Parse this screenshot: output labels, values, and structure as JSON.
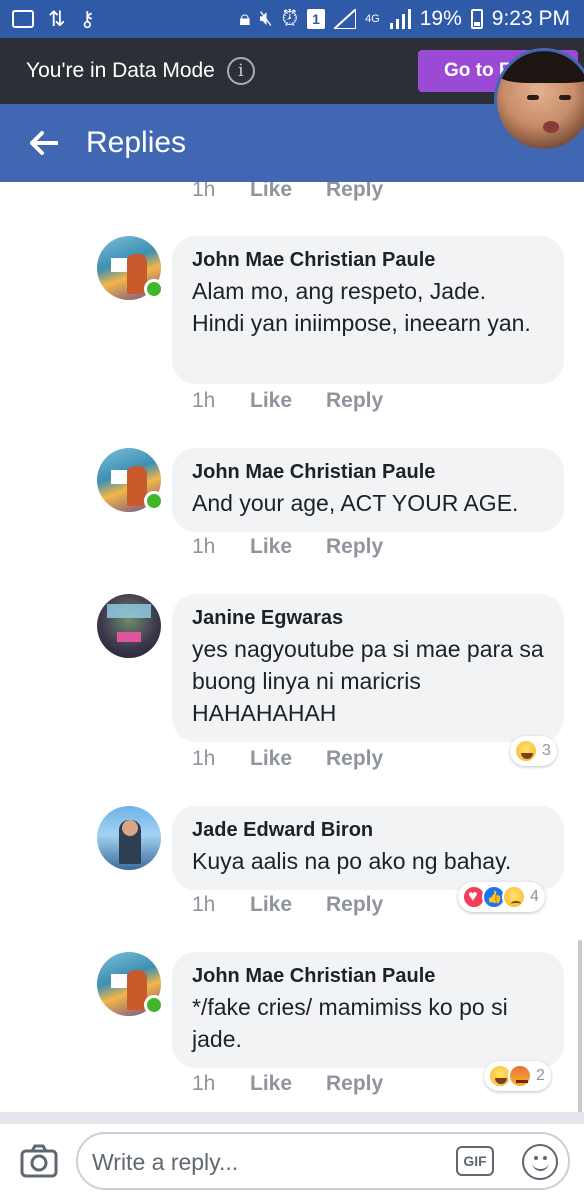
{
  "status_bar": {
    "network": "4G",
    "battery": "19%",
    "time": "9:23 PM",
    "sim_slot": "1"
  },
  "data_mode": {
    "message": "You're in Data Mode",
    "button_label": "Go to F"
  },
  "header": {
    "title": "Replies"
  },
  "colors": {
    "header": "#4267b2",
    "data_bar": "#2c2f36",
    "goto_button": "#9b4ad6",
    "bubble": "#f2f3f5",
    "online": "#42b72a"
  },
  "comments": [
    {
      "name": "",
      "text": "",
      "time": "1h",
      "like": "Like",
      "reply": "Reply"
    },
    {
      "name": "John Mae Christian Paule",
      "text": "Alam mo, ang respeto, Jade. Hindi yan iniimpose, ineearn yan.",
      "time": "1h",
      "like": "Like",
      "reply": "Reply",
      "online": true
    },
    {
      "name": "John Mae Christian Paule",
      "text": "And your age, ACT YOUR AGE.",
      "time": "1h",
      "like": "Like",
      "reply": "Reply",
      "online": true
    },
    {
      "name": "Janine Egwaras",
      "text": "yes nagyoutube pa si mae para sa buong linya ni maricris HAHAHAHAH",
      "time": "1h",
      "like": "Like",
      "reply": "Reply",
      "reactions": [
        "haha"
      ],
      "reaction_count": "3"
    },
    {
      "name": "Jade Edward Biron",
      "text": "Kuya aalis na po ako ng bahay.",
      "time": "1h",
      "like": "Like",
      "reply": "Reply",
      "reactions": [
        "love",
        "like",
        "sad"
      ],
      "reaction_count": "4"
    },
    {
      "name": "John Mae Christian Paule",
      "text": "*/fake cries/ mamimiss ko po si jade.",
      "time": "1h",
      "like": "Like",
      "reply": "Reply",
      "online": true,
      "reactions": [
        "haha",
        "angry"
      ],
      "reaction_count": "2"
    }
  ],
  "composer": {
    "placeholder": "Write a reply...",
    "gif_label": "GIF"
  }
}
